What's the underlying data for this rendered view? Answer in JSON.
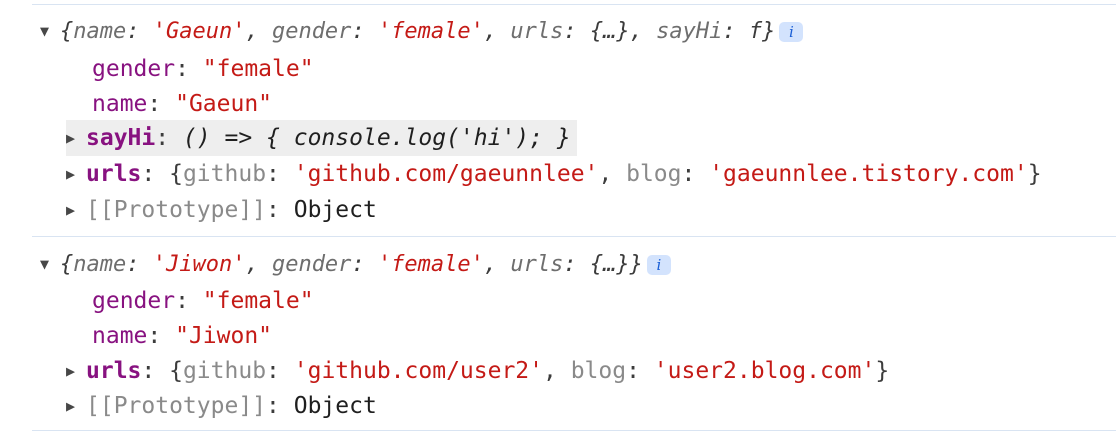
{
  "logs": [
    {
      "summary": {
        "open": "{",
        "k1": "name",
        "v1": "'Gaeun'",
        "k2": "gender",
        "v2": "'female'",
        "k3": "urls",
        "v3": "{…}",
        "k4": "sayHi",
        "v4": "f",
        "close": "}"
      },
      "info_badge": "i",
      "gender": {
        "key": "gender",
        "value": "\"female\""
      },
      "name": {
        "key": "name",
        "value": "\"Gaeun\""
      },
      "sayHi": {
        "key": "sayHi",
        "value": "() => { console.log('hi'); }"
      },
      "urls": {
        "key": "urls",
        "gk": "github",
        "gv": "'github.com/gaeunnlee'",
        "bk": "blog",
        "bv": "'gaeunnlee.tistory.com'"
      },
      "prototype": {
        "key": "[[Prototype]]",
        "value": "Object"
      }
    },
    {
      "summary": {
        "open": "{",
        "k1": "name",
        "v1": "'Jiwon'",
        "k2": "gender",
        "v2": "'female'",
        "k3": "urls",
        "v3": "{…}",
        "close": "}"
      },
      "info_badge": "i",
      "gender": {
        "key": "gender",
        "value": "\"female\""
      },
      "name": {
        "key": "name",
        "value": "\"Jiwon\""
      },
      "urls": {
        "key": "urls",
        "gk": "github",
        "gv": "'github.com/user2'",
        "bk": "blog",
        "bv": "'user2.blog.com'"
      },
      "prototype": {
        "key": "[[Prototype]]",
        "value": "Object"
      }
    }
  ],
  "glyphs": {
    "expanded": "▼",
    "collapsed": "▶",
    "colon": ":",
    "comma": ",",
    "lbrace": "{",
    "rbrace": "}"
  }
}
